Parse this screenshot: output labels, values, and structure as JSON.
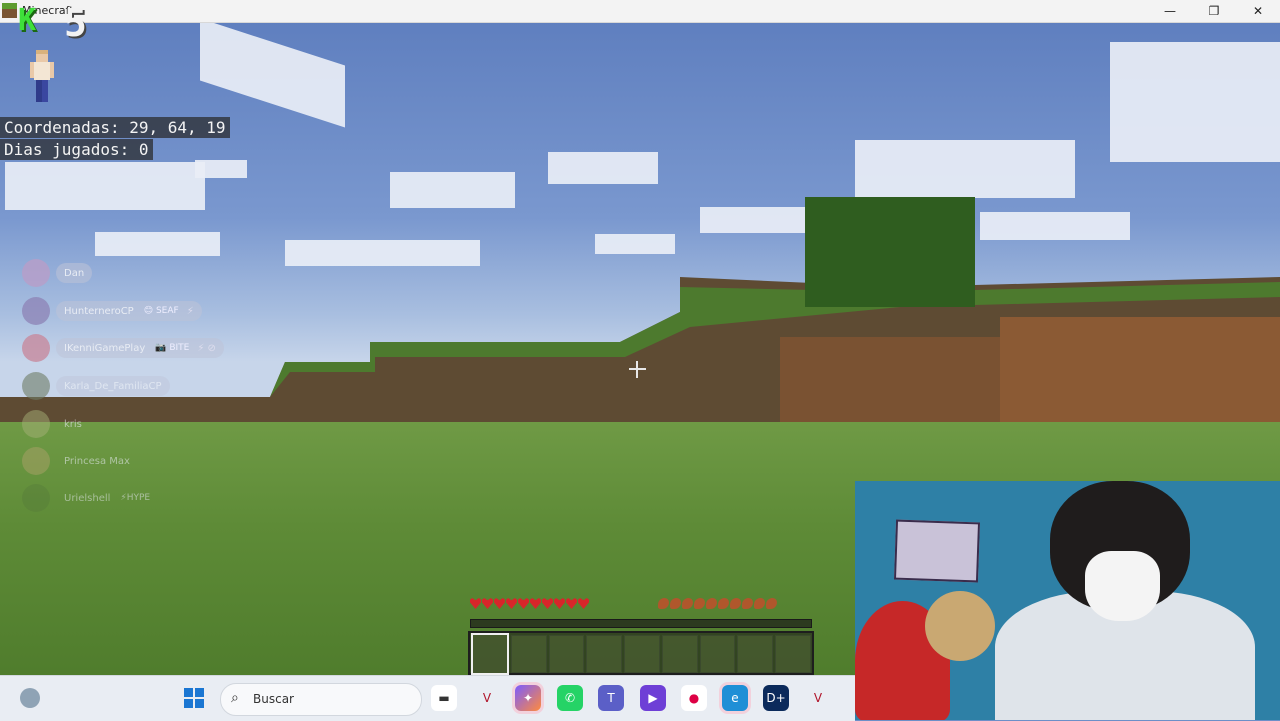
{
  "window": {
    "title": "Minecraft",
    "minimize": "—",
    "maximize": "❐",
    "close": "✕"
  },
  "overlay": {
    "logo_letter": "K",
    "logo_number": "5"
  },
  "hud": {
    "coordinates": "Coordenadas: 29, 64, 19",
    "days": "Dias jugados: 0"
  },
  "chat": [
    {
      "name": "Dan",
      "badge": "",
      "icons": ""
    },
    {
      "name": "HunterneroCP",
      "badge": "😊 SEAF",
      "icons": "⚡"
    },
    {
      "name": "IKenniGamePlay",
      "badge": "📷 BITE",
      "icons": "⚡ ⊘"
    },
    {
      "name": "Karla_De_FamiliaCP",
      "badge": "",
      "icons": ""
    },
    {
      "name": "kris",
      "badge": "",
      "icons": ""
    },
    {
      "name": "Princesa Max",
      "badge": "",
      "icons": ""
    },
    {
      "name": "Urielshell",
      "badge": "⚡HYPE",
      "icons": ""
    }
  ],
  "status": {
    "health_hearts": 10,
    "hunger": 10,
    "selected_slot": 1,
    "slots": 9
  },
  "taskbar": {
    "search_placeholder": "Buscar",
    "apps": [
      "file-explorer",
      "valorant",
      "copilot",
      "whatsapp",
      "teams",
      "clipchamp",
      "paint",
      "edge",
      "disney-plus",
      "valorant-2"
    ]
  }
}
